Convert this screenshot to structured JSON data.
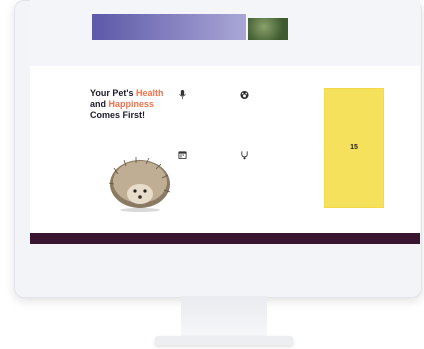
{
  "banner": {
    "title": "",
    "subtitle": ""
  },
  "thumb": {
    "title": "",
    "subtitle": ""
  },
  "hero": {
    "title_line1_a": "Your Pet's ",
    "title_line1_accent": "Health",
    "title_line2_a": "and ",
    "title_line2_accent": "Happiness",
    "title_line3": "Comes First!",
    "body": ""
  },
  "features": [
    {
      "icon": "microphone-icon",
      "title": "",
      "body": ""
    },
    {
      "icon": "paw-icon",
      "title": "",
      "body": ""
    },
    {
      "icon": "calendar-icon",
      "title": "",
      "body": ""
    },
    {
      "icon": "stethoscope-icon",
      "title": "",
      "body": ""
    }
  ],
  "badge": {
    "number": "15",
    "label": ""
  },
  "colors": {
    "accent": "#f0724a",
    "badge": "#f6e15d",
    "footer_bar": "#3a1530",
    "banner": "#5d58a8"
  }
}
